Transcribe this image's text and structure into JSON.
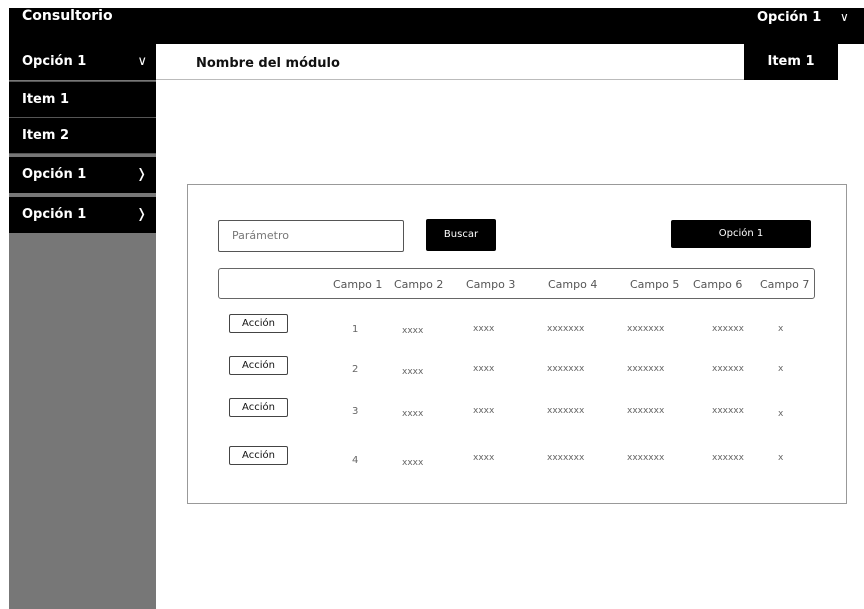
{
  "app": {
    "title": "Consultorio"
  },
  "topbar": {
    "menu_label": "Opción 1",
    "chevron": "∨"
  },
  "sidebar": {
    "items": [
      {
        "label": "Opción 1",
        "chevron": "∨"
      },
      {
        "label": "Item 1"
      },
      {
        "label": "Item 2"
      },
      {
        "label": "Opción 1",
        "chevron": "❭"
      },
      {
        "label": "Opción 1",
        "chevron": "❭"
      }
    ]
  },
  "module": {
    "title": "Nombre del módulo",
    "tab_label": "Item 1"
  },
  "search": {
    "placeholder": "Parámetro",
    "button_label": "Buscar",
    "option_button_label": "Opción 1"
  },
  "table": {
    "columns": [
      "Campo 1",
      "Campo 2",
      "Campo 3",
      "Campo 4",
      "Campo 5",
      "Campo 6",
      "Campo 7"
    ],
    "action_label": "Acción",
    "rows": [
      {
        "c1": "1",
        "c2": "xxxx",
        "c3": "xxxx",
        "c4": "xxxxxxx",
        "c5": "xxxxxxx",
        "c6": "xxxxxx",
        "c7": "x"
      },
      {
        "c1": "2",
        "c2": "xxxx",
        "c3": "xxxx",
        "c4": "xxxxxxx",
        "c5": "xxxxxxx",
        "c6": "xxxxxx",
        "c7": "x"
      },
      {
        "c1": "3",
        "c2": "xxxx",
        "c3": "xxxx",
        "c4": "xxxxxxx",
        "c5": "xxxxxxx",
        "c6": "xxxxxx",
        "c7": "x"
      },
      {
        "c1": "4",
        "c2": "xxxx",
        "c3": "xxxx",
        "c4": "xxxxxxx",
        "c5": "xxxxxxx",
        "c6": "xxxxxx",
        "c7": "x"
      }
    ]
  },
  "colors": {
    "bar": "#000000",
    "sidebar_bg": "#777777",
    "card_border": "#999999"
  }
}
